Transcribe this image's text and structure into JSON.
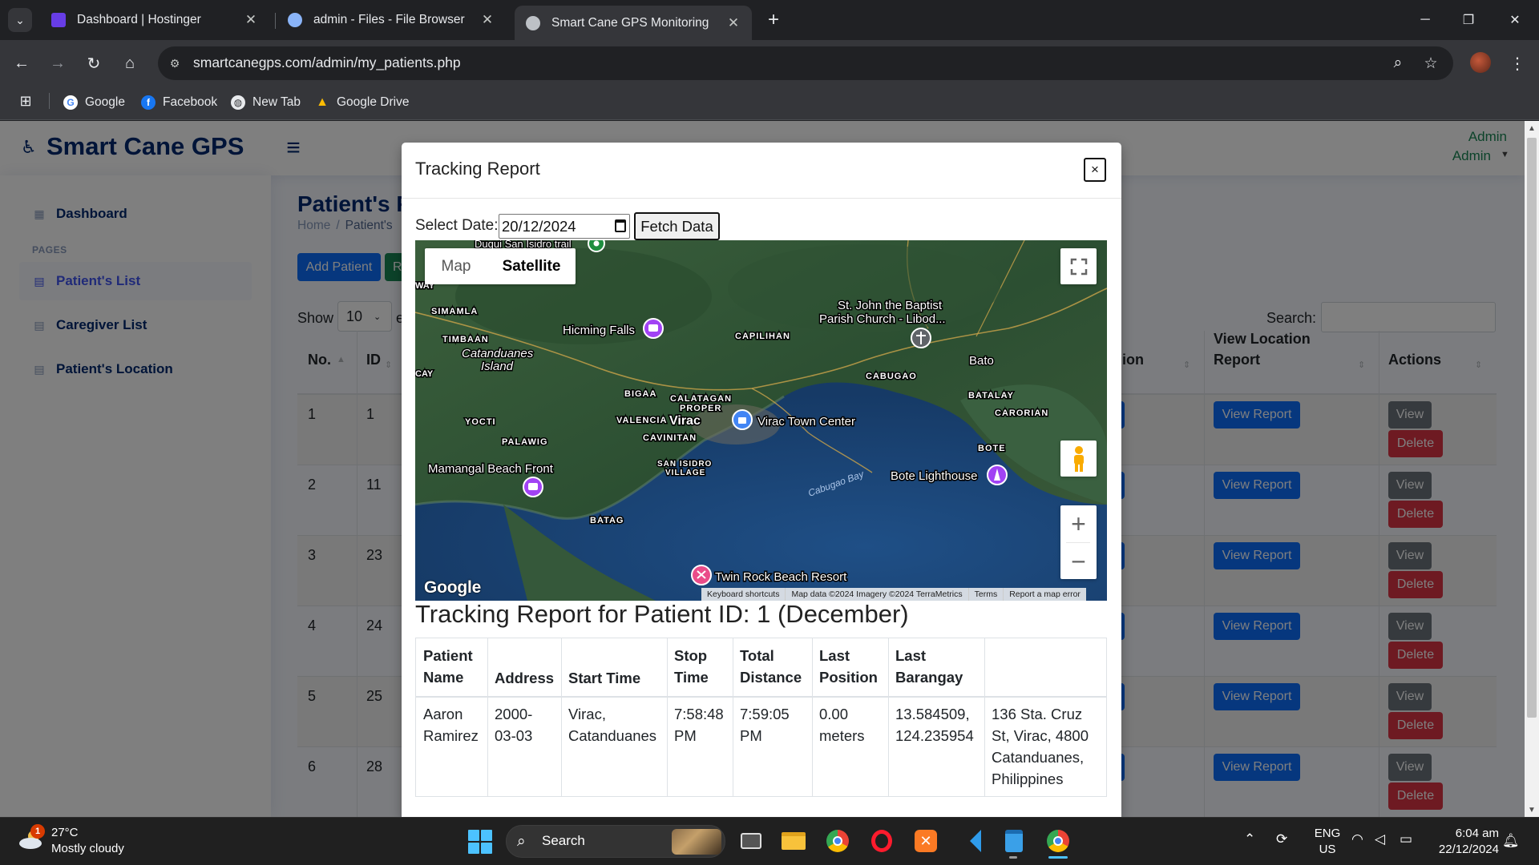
{
  "browser": {
    "tabs": [
      {
        "title": "Dashboard | Hostinger",
        "close": "✕"
      },
      {
        "title": "admin - Files - File Browser",
        "close": "✕"
      },
      {
        "title": "Smart Cane GPS Monitoring",
        "close": "✕"
      }
    ],
    "url": "smartcanegps.com/admin/my_patients.php",
    "bookmarks": [
      "Google",
      "Facebook",
      "New Tab",
      "Google Drive"
    ]
  },
  "app": {
    "logo": "Smart Cane GPS",
    "user_name": "Admin",
    "user_role": "Admin",
    "sidebar": {
      "dashboard": "Dashboard",
      "heading": "PAGES",
      "items": [
        "Patient's List",
        "Caregiver List",
        "Patient's Location"
      ]
    },
    "page_title": "Patient's P",
    "breadcrumb": {
      "home": "Home",
      "sep": "/",
      "current": "Patient's"
    },
    "add_button": "Add Patient",
    "green_button": "R",
    "show_label": "Show",
    "show_value": "10",
    "show_suffix": "e",
    "search_label": "Search:",
    "columns": {
      "no": "No.",
      "id": "ID",
      "loc_partial": "ion",
      "view_report_1": "View Location",
      "view_report_2": "Report",
      "actions": "Actions"
    },
    "rows": [
      {
        "no": "1",
        "id": "1"
      },
      {
        "no": "2",
        "id": "11"
      },
      {
        "no": "3",
        "id": "23"
      },
      {
        "no": "4",
        "id": "24"
      },
      {
        "no": "5",
        "id": "25"
      },
      {
        "no": "6",
        "id": "28"
      }
    ],
    "row_buttons": {
      "report": "View Report",
      "view": "View",
      "delete": "Delete"
    }
  },
  "modal": {
    "title": "Tracking Report",
    "close": "×",
    "date_label": "Select Date:",
    "date_value": "20/12/2024",
    "fetch_button": "Fetch Data",
    "map": {
      "type_map": "Map",
      "type_satellite": "Satellite",
      "zoom_in": "+",
      "zoom_out": "−",
      "logo": "Google",
      "footer": [
        "Keyboard shortcuts",
        "Map data ©2024 Imagery ©2024 TerraMetrics",
        "Terms",
        "Report a map error"
      ],
      "labels": {
        "duqui": "Duqui San Isidro trail",
        "simamla": "SIMAMLA",
        "timbaan": "TIMBAAN",
        "catanduanes1": "Catanduanes",
        "catanduanes2": "Island",
        "cay": "CAY",
        "way": "WAY",
        "hicming": "Hicming Falls",
        "capilihan": "CAPILIHAN",
        "stjohn1": "St. John the Baptist",
        "stjohn2": "Parish Church - Libod...",
        "bato": "Bato",
        "cabugao": "CABUGAO",
        "batalay": "BATALAY",
        "carorian": "CARORIAN",
        "bigaa": "BIGAA",
        "calatagan1": "CALATAGAN",
        "calatagan2": "PROPER",
        "yocti": "YOCTI",
        "valencia": "VALENCIA",
        "virac": "Virac",
        "virac_center": "Virac Town Center",
        "palawig": "PALAWIG",
        "cavinitan": "CAVINITAN",
        "sanisidro1": "SAN ISIDRO",
        "sanisidro2": "VILLAGE",
        "cabugao_bay": "Cabugao Bay",
        "bote": "BOTE",
        "bote_lighthouse": "Bote Lighthouse",
        "mamangal": "Mamangal Beach Front",
        "batag": "BATAG",
        "twinrock": "Twin Rock Beach Resort"
      }
    },
    "report_title": "Tracking Report for Patient ID: 1 (December)",
    "report_table": {
      "headers": [
        [
          "Patient",
          "Name"
        ],
        [
          "Address",
          ""
        ],
        [
          "Start Time",
          ""
        ],
        [
          "Stop",
          "Time"
        ],
        [
          "Total",
          "Distance"
        ],
        [
          "Last",
          "Position"
        ],
        [
          "Last",
          "Barangay"
        ]
      ],
      "row": [
        [
          "Aaron",
          "Ramirez"
        ],
        [
          "2000-",
          "03-03"
        ],
        [
          "Virac,",
          "Catanduanes"
        ],
        [
          "7:58:48",
          "PM"
        ],
        [
          "7:59:05",
          "PM"
        ],
        [
          "0.00",
          "meters"
        ],
        [
          "13.584509,",
          "124.235954"
        ],
        [
          "136 Sta. Cruz",
          "St, Virac, 4800",
          "Catanduanes,",
          "Philippines"
        ]
      ]
    }
  },
  "taskbar": {
    "weather_badge": "1",
    "temperature": "27°C",
    "weather": "Mostly cloudy",
    "search": "Search",
    "lang1": "ENG",
    "lang2": "US",
    "time": "6:04 am",
    "date": "22/12/2024"
  }
}
